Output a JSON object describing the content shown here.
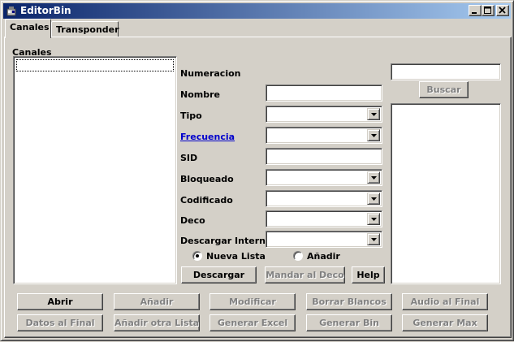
{
  "window": {
    "title": "EditorBin",
    "icon": "app-icon",
    "controls": [
      "minimize",
      "maximize",
      "close"
    ]
  },
  "tabs": [
    {
      "label": "Canales",
      "active": true
    },
    {
      "label": "Transponder",
      "active": false
    }
  ],
  "channels_panel": {
    "label": "Canales",
    "items": []
  },
  "form": {
    "numeracion_label": "Numeracion",
    "nombre_label": "Nombre",
    "nombre_value": "",
    "tipo_label": "Tipo",
    "tipo_value": "",
    "frecuencia_label": "Frecuencia",
    "frecuencia_value": "",
    "sid_label": "SID",
    "sid_value": "",
    "bloqueado_label": "Bloqueado",
    "bloqueado_value": "",
    "codificado_label": "Codificado",
    "codificado_value": "",
    "deco_label": "Deco",
    "deco_value": "",
    "descargar_internet_label": "Descargar Internet",
    "descargar_internet_value": ""
  },
  "radio": {
    "nueva_lista": "Nueva Lista",
    "anadir": "Añadir",
    "selected": "nueva_lista"
  },
  "form_buttons": {
    "descargar": "Descargar",
    "mandar_deco": "Mandar al Deco",
    "help": "Help"
  },
  "search": {
    "value": "",
    "button": "Buscar",
    "results": []
  },
  "bottom_buttons": {
    "row1": [
      "Abrir",
      "Añadir",
      "Modificar",
      "Borrar Blancos",
      "Audio al Final"
    ],
    "row2": [
      "Datos al Final",
      "Añadir otra Lista",
      "Generar Excel",
      "Generar Bin",
      "Generar Max"
    ]
  },
  "colors": {
    "face": "#d4d0c8",
    "titlebar_start": "#0a246a",
    "titlebar_end": "#a6caf0",
    "link": "#0000cc",
    "disabled_text": "#808080"
  }
}
